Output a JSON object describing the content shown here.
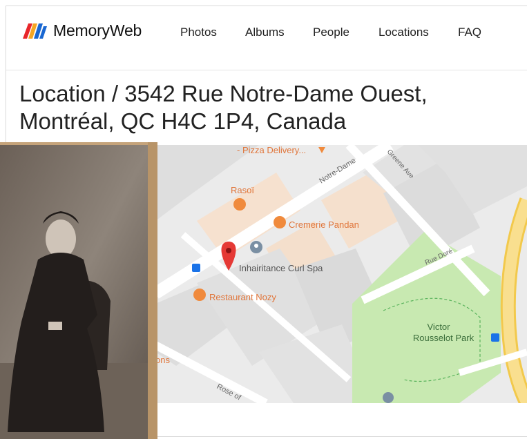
{
  "brand": {
    "name": "MemoryWeb",
    "colors": {
      "red": "#e8262a",
      "blue": "#1967d2"
    }
  },
  "nav": {
    "items": [
      "Photos",
      "Albums",
      "People",
      "Locations",
      "FAQ"
    ]
  },
  "page": {
    "title": "Location / 3542 Rue Notre-Dame Ouest, Montréal, QC H4C 1P4, Canada"
  },
  "map": {
    "labels": {
      "pizza": "- Pizza Delivery...",
      "street_notre_dame": "Notre-Dame",
      "street_greene": "Greene Ave",
      "rasoi": "Rasoï",
      "cremerie": "Cremerie Pandan",
      "rue_dore": "Rue Doré",
      "spa": "Inhairitance Curl Spa",
      "restaurant": "Restaurant Nozy",
      "park_line1": "Victor",
      "park_line2": "Rousselot Park",
      "partial_ons": "ons",
      "rose": "Rose of"
    },
    "colors": {
      "road": "#ffffff",
      "block": "#dcdcdc",
      "food": "#f9e3cf",
      "park": "#c9eab2",
      "highway": "#f7d984",
      "poi_orange": "#f08a3c",
      "pin_red": "#e53935"
    }
  },
  "photo": {
    "description_icon": "vintage-portrait-photo"
  }
}
